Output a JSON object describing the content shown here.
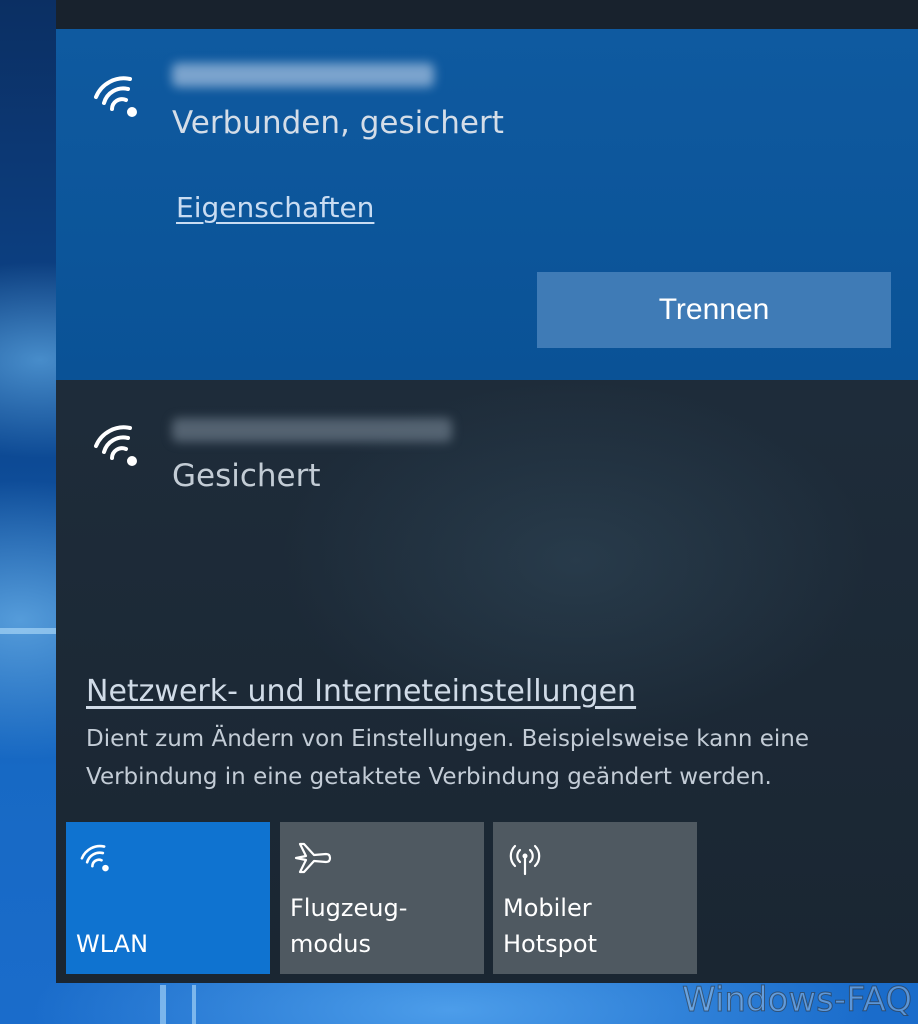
{
  "networks": {
    "connected": {
      "status": "Verbunden, gesichert",
      "properties_link": "Eigenschaften",
      "disconnect_label": "Trennen",
      "icon": "wifi-icon"
    },
    "second": {
      "status": "Gesichert",
      "icon": "wifi-icon"
    }
  },
  "settings": {
    "link": "Netzwerk- und Interneteinstellungen",
    "description": "Dient zum Ändern von Einstellungen. Beispielsweise kann eine Verbindung in eine getaktete Verbindung geändert werden."
  },
  "tiles": [
    {
      "label": "WLAN",
      "icon": "wifi-icon",
      "active": true
    },
    {
      "label": "Flugzeug-\nmodus",
      "icon": "airplane-icon",
      "active": false
    },
    {
      "label": "Mobiler\nHotspot",
      "icon": "hotspot-icon",
      "active": false
    }
  ],
  "watermark": "Windows-FAQ",
  "colors": {
    "connected_bg": "#0a5296",
    "panel_bg": "#1e2c3a",
    "active_tile": "#0f73d0",
    "inactive_tile": "#4f5961",
    "button": "#3f7bb6"
  }
}
